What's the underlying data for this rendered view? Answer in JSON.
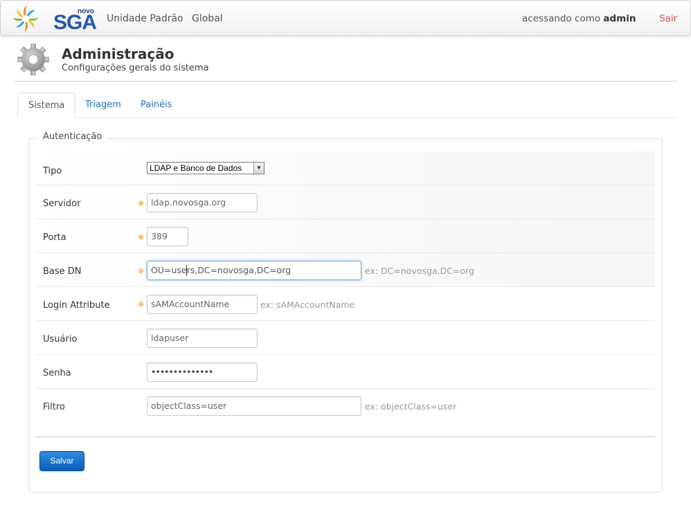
{
  "brand": {
    "small": "novo",
    "name": "SGA"
  },
  "nav": {
    "links": [
      "Unidade Padrão",
      "Global"
    ],
    "user_prefix": "acessando como ",
    "user_name": "admin",
    "logout": "Sair"
  },
  "header": {
    "title": "Administração",
    "subtitle": "Configurações gerais do sistema"
  },
  "tabs": [
    {
      "label": "Sistema",
      "active": true
    },
    {
      "label": "Triagem",
      "active": false
    },
    {
      "label": "Painéis",
      "active": false
    }
  ],
  "form": {
    "legend": "Autenticação",
    "fields": {
      "tipo": {
        "label": "Tipo",
        "value": "LDAP e Banco de Dados"
      },
      "servidor": {
        "label": "Servidor",
        "value": "ldap.novosga.org",
        "required": true
      },
      "porta": {
        "label": "Porta",
        "value": "389",
        "required": true
      },
      "base_dn": {
        "label": "Base DN",
        "value": "OU=users,DC=novosga,DC=org",
        "hint": "ex: DC=novosga,DC=org",
        "required": true
      },
      "login_attribute": {
        "label": "Login Attribute",
        "value": "sAMAccountName",
        "hint": "ex: sAMAccountName",
        "required": true
      },
      "usuario": {
        "label": "Usuário",
        "value": "ldapuser"
      },
      "senha": {
        "label": "Senha",
        "value": "••••••••••••••"
      },
      "filtro": {
        "label": "Filtro",
        "value": "objectClass=user",
        "hint": "ex: objectClass=user"
      }
    },
    "submit": "Salvar"
  },
  "colors": {
    "accent": "#1f6fb5",
    "logout": "#d9534f",
    "required_dot": "#f0a030",
    "button": "#0a5fb8"
  }
}
